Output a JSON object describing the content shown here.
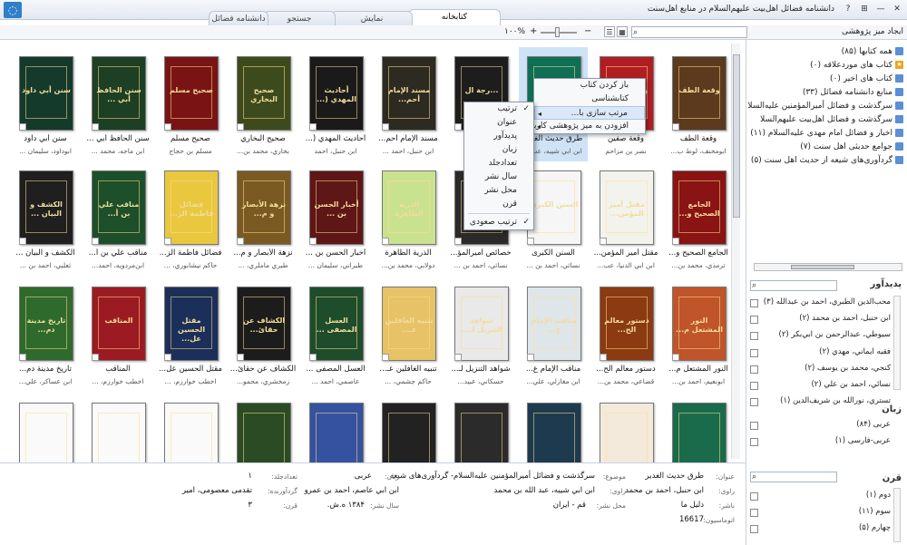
{
  "window": {
    "title": "دانشنامه فضائل اهل‌بیت علیهم‌السلام در منابع اهل‌سنت",
    "controls": [
      "?",
      "⊞",
      "—",
      "✕"
    ]
  },
  "tabs": [
    {
      "label": "کتابخانه",
      "active": true
    },
    {
      "label": "نمایش",
      "active": false
    },
    {
      "label": "جستجو",
      "active": false
    },
    {
      "label": "دانشنامه فضائل",
      "active": false
    }
  ],
  "toolbar": {
    "new_desk": "ایجاد میز پژوهشی",
    "zoom": "۱۰۰%",
    "minus": "−",
    "plus": "+"
  },
  "tree": [
    {
      "label": "همه کتابها (۸۵)"
    },
    {
      "label": "کتاب های موردعلاقه (۰)"
    },
    {
      "label": "کتاب های اخیر (۰)"
    },
    {
      "label": "منابع دانشنامه فضائل (۳۳)"
    },
    {
      "label": "سرگذشت و فضائل أميرالمؤمنين عليه‌السلا"
    },
    {
      "label": "سرگذشت و فضائل اهل‌بیت علیهم‌السلا"
    },
    {
      "label": "اخبار و فضائل امام مهدی علیه‌السلام (۱۱)"
    },
    {
      "label": "جوامع حدیثی اهل سنت (۷)"
    },
    {
      "label": "گردآوری‌های شیعه از حدیث اهل سنت (۵)"
    }
  ],
  "filters": {
    "author_header": "پدیدآور",
    "authors": [
      "محب‌الدين الطبري، احمد بن عبدالله (۳)",
      "ابن حنبل، احمد بن محمد (۲)",
      "سيوطي، عبدالرحمن بن ابي‌بكر (۲)",
      "فقيه ايماني، مهدي (۲)",
      "كنجي، محمد بن يوسف (۲)",
      "نسائي، احمد بن علي (۲)",
      "تستري، نورالله بن شريف‌الدين (۱)"
    ],
    "language_header": "زبان",
    "languages": [
      "عربی (۸۴)",
      "عربی-فارسی (۱)"
    ],
    "century_header": "قرن",
    "centuries": [
      "دوم (۱)",
      "سوم (۱۱)",
      "چهارم (۵)"
    ]
  },
  "books": [
    {
      "title": "وقعة الطف",
      "author": "ابومخنف، لوط ب...",
      "color": "#5b3a1e"
    },
    {
      "title": "وقعة صفين",
      "author": "نصر بن مزاحم",
      "color": "#b01e22"
    },
    {
      "title": "طرق حديث الغدير",
      "author": "ابن ابي شيبه، عب...",
      "color": "#0f6f55"
    },
    {
      "title": "...رجة ال",
      "author": "",
      "color": "#1d1d1d"
    },
    {
      "title": "مسند الإمام أحم...",
      "author": "ابن حنبل، احمد ...",
      "color": "#2d2a22"
    },
    {
      "title": "أحاديث المهدي (...",
      "author": "ابن حنبل، احمد",
      "color": "#1a1a1a"
    },
    {
      "title": "صحيح البخاري",
      "author": "بخاري، محمد بن...",
      "color": "#3d4a1c"
    },
    {
      "title": "صحيح مسلم",
      "author": "مسلم بن حجاج",
      "color": "#7a1414"
    },
    {
      "title": "سنن الحافظ أبي ...",
      "author": "ابن ماجه، محمد ...",
      "color": "#1d3f24"
    },
    {
      "title": "سنن أبي داود",
      "author": "ابوداود، سليمان ...",
      "color": "#143a2c"
    },
    {
      "title": "الجامع الصحيح و...",
      "author": "ترمذي، محمد بن...",
      "color": "#8a1313"
    },
    {
      "title": "مقتل أمير المؤمن...",
      "author": "ابن ابي الدنيا، عب...",
      "color": "#f3f3ee"
    },
    {
      "title": "السنن الكبرى",
      "author": "نسائي، احمد بن ...",
      "color": "#f6f6f6"
    },
    {
      "title": "خصائص أميرالمؤ...",
      "author": "نسائي، احمد بن ...",
      "color": "#2a2a2a"
    },
    {
      "title": "الذرية الطاهرة",
      "author": "دولابي، محمد بن...",
      "color": "#c9e28f"
    },
    {
      "title": "أخبار الحسن بن ...",
      "author": "طبراني، سليمان ...",
      "color": "#5e1616"
    },
    {
      "title": "نزهة الأبصار و م...",
      "author": "طبري ماملري، ...",
      "color": "#7a5a22"
    },
    {
      "title": "فضائل فاطمة الز...",
      "author": "حاكم نيشابوري، ...",
      "color": "#e9c840"
    },
    {
      "title": "مناقب علي بن أ...",
      "author": "ابن‌مردويه، احمد...",
      "color": "#1c4f2a"
    },
    {
      "title": "الكشف و البيان ...",
      "author": "ثعلبي، احمد بن ...",
      "color": "#1f1f1f"
    },
    {
      "title": "النور المشتعل م...",
      "author": "ابونعيم، احمد بن...",
      "color": "#c0542a"
    },
    {
      "title": "دستور معالم الح...",
      "author": "قضاعي، محمد بن...",
      "color": "#8b3a12"
    },
    {
      "title": "مناقب الإمام ع...",
      "author": "ابن مغازلي، علي...",
      "color": "#dfe6ea"
    },
    {
      "title": "شواهد التنزيل لـ...",
      "author": "حسكاني، عبيد...",
      "color": "#e9e9e9"
    },
    {
      "title": "تنبيه الغافلين عـ...",
      "author": "حاكم جشمي، ...",
      "color": "#e8c267"
    },
    {
      "title": "العسل المصفى ...",
      "author": "عاصمي، احمد ...",
      "color": "#1d4d2b"
    },
    {
      "title": "الكشاف عن حقائ...",
      "author": "زمخشري، محمو...",
      "color": "#1c1c1c"
    },
    {
      "title": "مقتل الحسين عل...",
      "author": "اخطب خوارزم، ...",
      "color": "#1b2f5a"
    },
    {
      "title": "المناقب",
      "author": "اخطب خوارزم، ...",
      "color": "#9c1b22"
    },
    {
      "title": "تاريخ مدينة دم...",
      "author": "ابن عساكر، علي...",
      "color": "#2f6a2d"
    },
    {
      "title": "",
      "author": "",
      "color": "#1a6b4b"
    },
    {
      "title": "",
      "author": "",
      "color": "#f3eadb"
    },
    {
      "title": "",
      "author": "",
      "color": "#1e3a4e"
    },
    {
      "title": "",
      "author": "",
      "color": "#2b2b2b"
    },
    {
      "title": "",
      "author": "",
      "color": "#222"
    },
    {
      "title": "",
      "author": "",
      "color": "#3552a0"
    },
    {
      "title": "",
      "author": "",
      "color": "#2b4b25"
    },
    {
      "title": "",
      "author": "",
      "color": "#fafafa"
    },
    {
      "title": "",
      "author": "",
      "color": "#fafafa"
    },
    {
      "title": "",
      "author": "",
      "color": "#fafafa"
    }
  ],
  "context_menu": {
    "items": [
      "باز کردن کتاب",
      "کتابشناسی",
      "مرتب سازی با...",
      "افزودن به میز پژوهشی کاربر"
    ]
  },
  "sort_menu": {
    "items": [
      "ترتیب",
      "عنوان",
      "پدیدآور",
      "زبان",
      "تعدادجلد",
      "سال نشر",
      "محل نشر",
      "قرن",
      "ترتیب صعودی"
    ]
  },
  "detail": {
    "labels": {
      "title": "عنوان:",
      "subject": "موضوع:",
      "language": "زبان:",
      "volumes": "تعدادجلد:",
      "narrator": "راوی:",
      "compiler": "گردآورنده:",
      "publisher": "ناشر:",
      "place": "محل نشر:",
      "year": "سال نشر:",
      "century": "قرن:",
      "auto_no": "اتوماسیون:"
    },
    "values": {
      "title": "طرق حديث الغدير",
      "subject": "سرگذشت و فضائل أميرالمؤمنين عليه‌السلام- گردآوری‌های شيعه",
      "language": "عربی",
      "volumes": "۱",
      "narrator1": "ابن حنبل، احمد بن محمد",
      "narrator2": "ابن ابي شيبه، عبد الله بن محمد",
      "narrator3": "ابن ابي عاصم، احمد بن عمرو",
      "compiler": "تقدمی معصومی، امير",
      "publisher": "دليل ما",
      "place": "قم - ايران",
      "year": "۱۳۸۴ ه.ش.",
      "century": "۳",
      "auto_no": "16617"
    }
  }
}
